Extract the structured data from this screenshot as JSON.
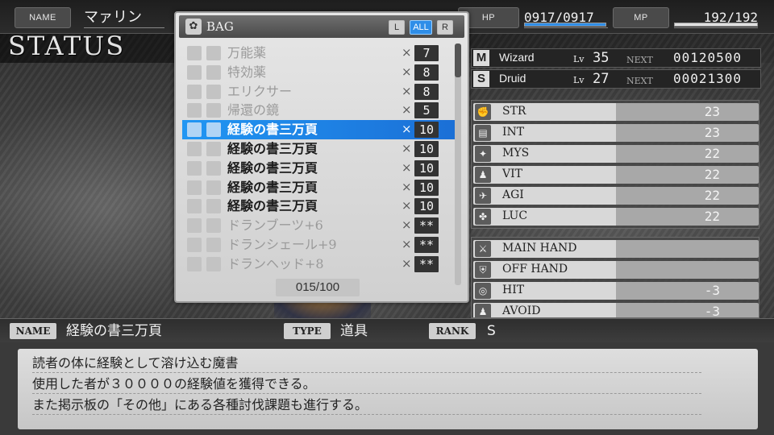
{
  "top": {
    "name_label": "NAME",
    "name_value": "マァリン",
    "hp_label": "HP",
    "hp_value": "0917/0917",
    "hp_fill": 1.0,
    "mp_label": "MP",
    "mp_value": "192/192",
    "mp_fill": 1.0
  },
  "header": {
    "title": "STATUS"
  },
  "bag": {
    "title": "BAG",
    "tabs": [
      {
        "label": "L",
        "active": false
      },
      {
        "label": "ALL",
        "active": true
      },
      {
        "label": "R",
        "active": false
      }
    ],
    "times": "×",
    "items": [
      {
        "name": "万能薬",
        "qty": "7",
        "state": "dim"
      },
      {
        "name": "特効薬",
        "qty": "8",
        "state": "dim"
      },
      {
        "name": "エリクサー",
        "qty": "8",
        "state": "dim"
      },
      {
        "name": "帰還の鏡",
        "qty": "5",
        "state": "dim"
      },
      {
        "name": "経験の書三万頁",
        "qty": "10",
        "state": "selected"
      },
      {
        "name": "経験の書三万頁",
        "qty": "10",
        "state": "usable"
      },
      {
        "name": "経験の書三万頁",
        "qty": "10",
        "state": "usable"
      },
      {
        "name": "経験の書三万頁",
        "qty": "10",
        "state": "usable"
      },
      {
        "name": "経験の書三万頁",
        "qty": "10",
        "state": "usable"
      },
      {
        "name": "ドランブーツ+6",
        "qty": "**",
        "state": "dim"
      },
      {
        "name": "ドランシェール+9",
        "qty": "**",
        "state": "dim"
      },
      {
        "name": "ドランヘッド+8",
        "qty": "**",
        "state": "dim"
      }
    ],
    "count": "015/100"
  },
  "classes": [
    {
      "icon": "M",
      "name": "Wizard",
      "lv_label": "Lv",
      "lv": "35",
      "next_label": "NEXT",
      "next": "00120500"
    },
    {
      "icon": "S",
      "name": "Druid",
      "lv_label": "Lv",
      "lv": "27",
      "next_label": "NEXT",
      "next": "00021300"
    }
  ],
  "stats": [
    {
      "icon": "str-icon",
      "glyph": "✊",
      "name": "STR",
      "value": "23"
    },
    {
      "icon": "int-icon",
      "glyph": "▤",
      "name": "INT",
      "value": "23"
    },
    {
      "icon": "mys-icon",
      "glyph": "✦",
      "name": "MYS",
      "value": "22"
    },
    {
      "icon": "vit-icon",
      "glyph": "♟",
      "name": "VIT",
      "value": "22"
    },
    {
      "icon": "agi-icon",
      "glyph": "✈",
      "name": "AGI",
      "value": "22"
    },
    {
      "icon": "luc-icon",
      "glyph": "✤",
      "name": "LUC",
      "value": "22"
    }
  ],
  "equipment": [
    {
      "icon": "main-hand-icon",
      "glyph": "⚔",
      "name": "MAIN HAND",
      "value": ""
    },
    {
      "icon": "off-hand-icon",
      "glyph": "⛨",
      "name": "OFF HAND",
      "value": ""
    },
    {
      "icon": "hit-icon",
      "glyph": "◎",
      "name": "HIT",
      "value": "-3"
    },
    {
      "icon": "avoid-icon",
      "glyph": "♟",
      "name": "AVOID",
      "value": "-3"
    }
  ],
  "info": {
    "name_label": "NAME",
    "name_value": "経験の書三万頁",
    "type_label": "TYPE",
    "type_value": "道具",
    "rank_label": "RANK",
    "rank_value": "S"
  },
  "description": [
    "読者の体に経験として溶け込む魔書",
    "使用した者が３００００の経験値を獲得できる。",
    "また掲示板の「その他」にある各種討伐課題も進行する。"
  ],
  "colors": {
    "selection": "#2196f3",
    "hp_bar": "#2f8ee8",
    "mp_bar": "#e0e0e0"
  }
}
